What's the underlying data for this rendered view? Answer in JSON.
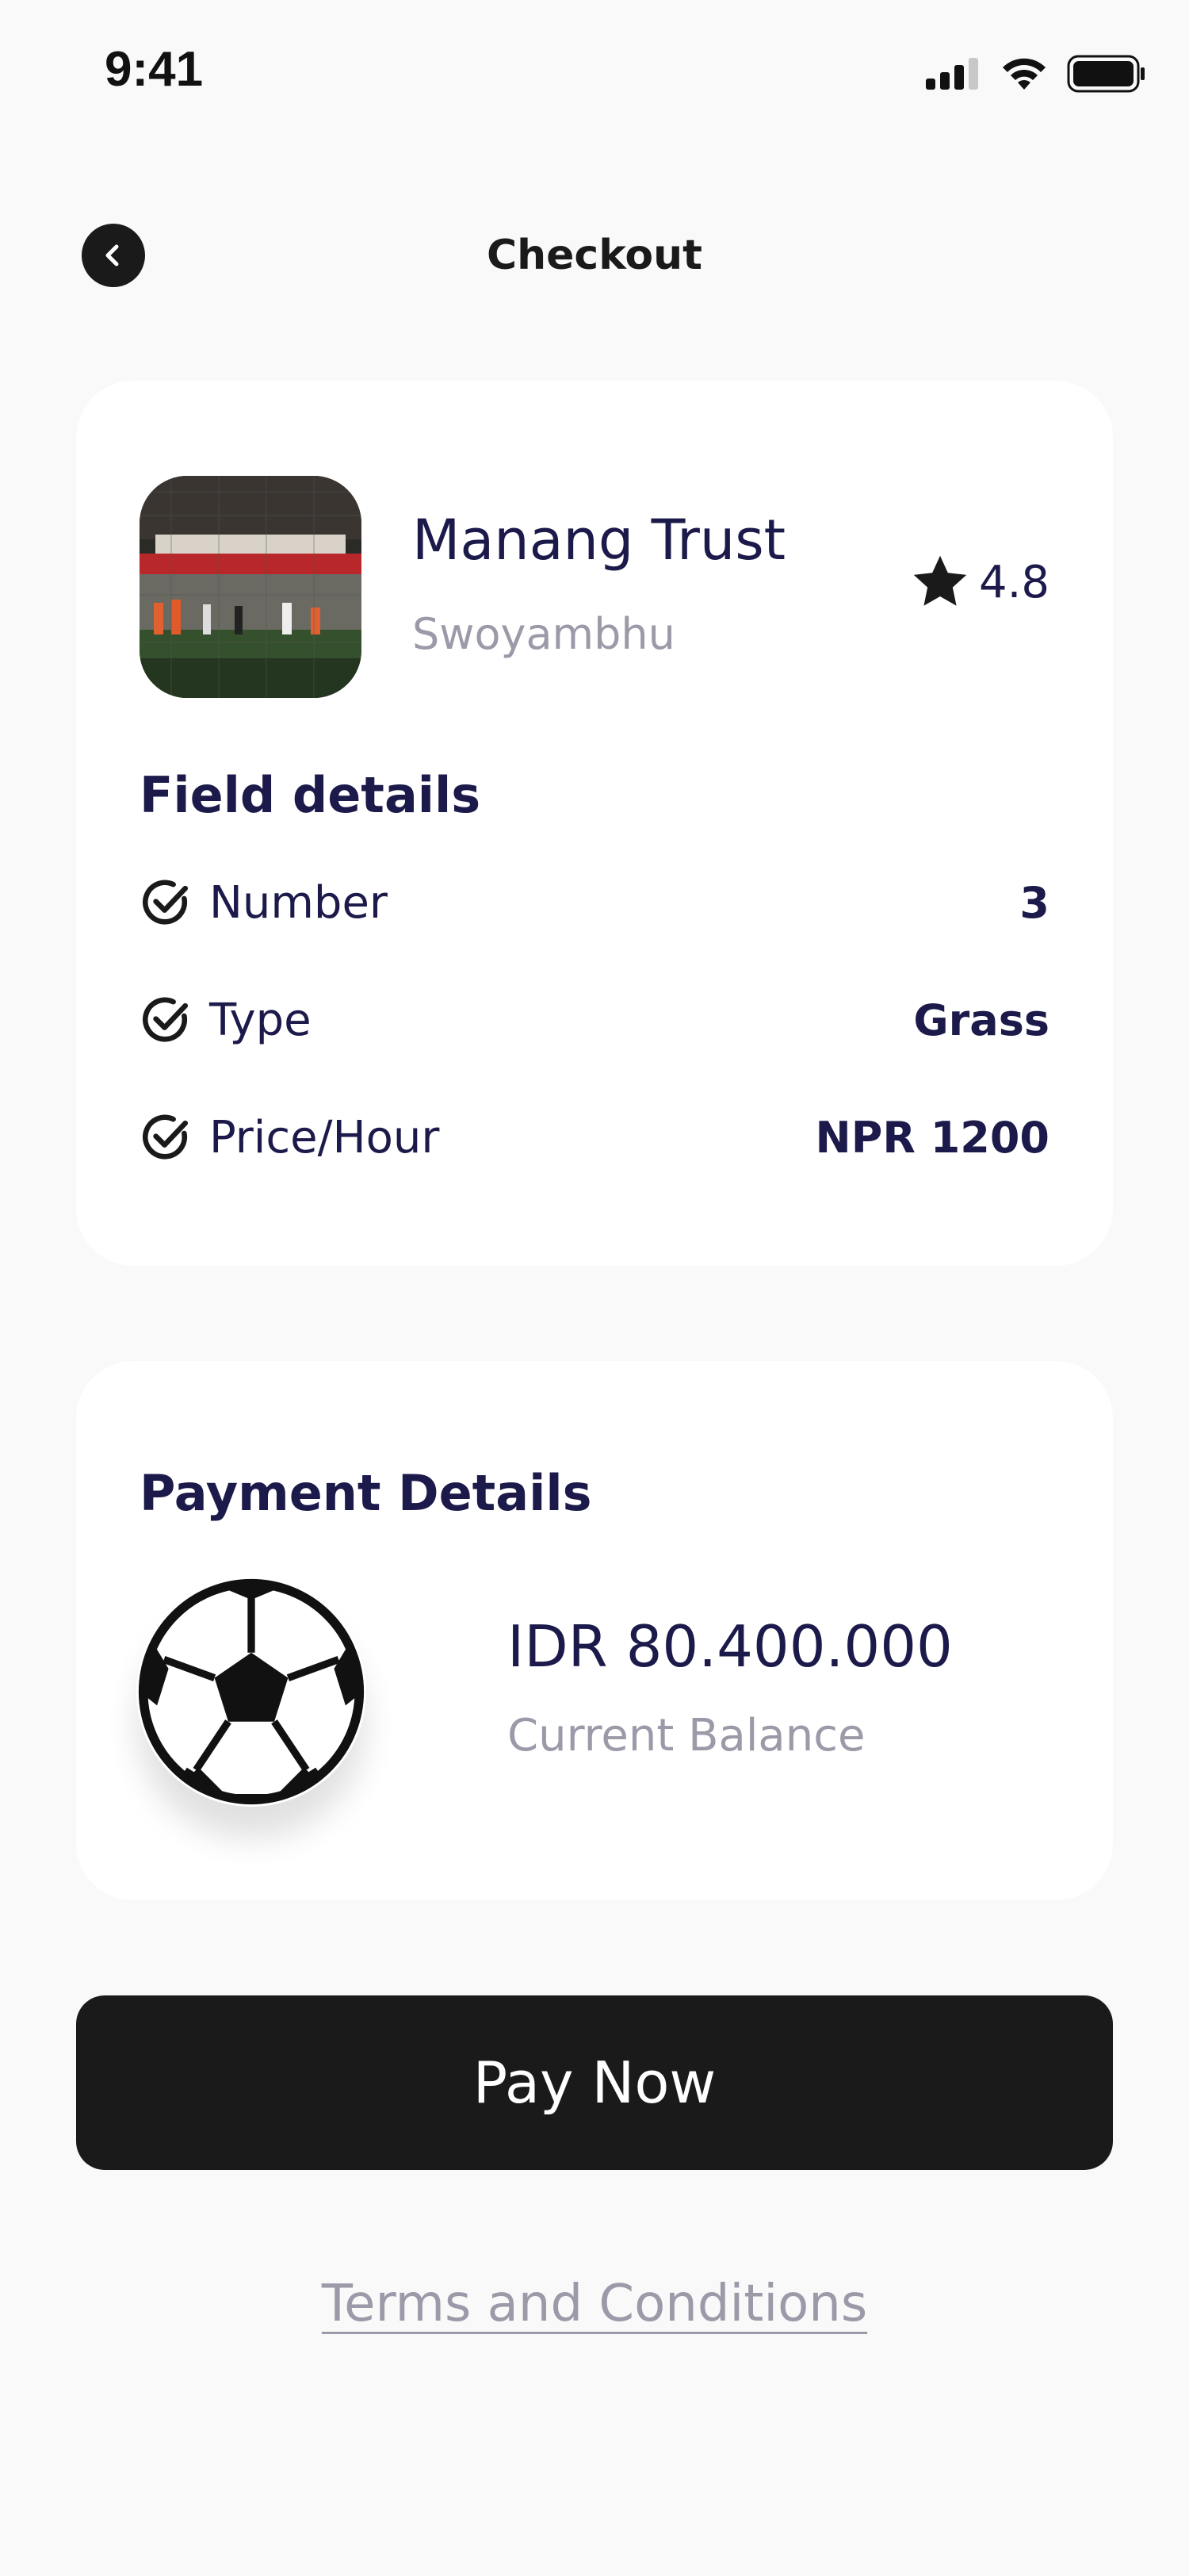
{
  "status_bar": {
    "time": "9:41"
  },
  "header": {
    "title": "Checkout"
  },
  "venue": {
    "name": "Manang Trust",
    "location": "Swoyambhu",
    "rating": "4.8"
  },
  "field_details": {
    "title": "Field details",
    "rows": [
      {
        "label": "Number",
        "value": "3"
      },
      {
        "label": "Type",
        "value": "Grass"
      },
      {
        "label": "Price/Hour",
        "value": "NPR 1200"
      }
    ]
  },
  "payment_details": {
    "title": "Payment Details",
    "balance_amount": "IDR 80.400.000",
    "balance_label": "Current Balance"
  },
  "actions": {
    "pay_label": "Pay Now",
    "terms_label": "Terms and Conditions"
  },
  "icons": {
    "back": "chevron-left-icon",
    "rating": "star-icon",
    "detail_check": "check-circle-icon",
    "payment": "soccer-ball-icon"
  },
  "colors": {
    "background": "#f9f9f9",
    "card": "#ffffff",
    "primary_text": "#1c1a4a",
    "muted_text": "#9b9aa8",
    "button": "#1a1a1a"
  }
}
